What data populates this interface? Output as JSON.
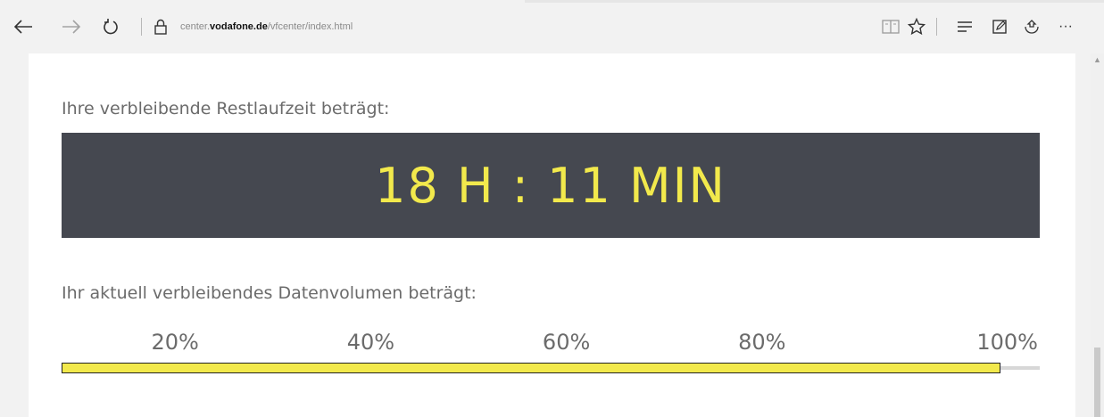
{
  "browser": {
    "url_prefix": "center.",
    "url_domain": "vodafone.de",
    "url_path": "/vfcenter/index.html",
    "icons": {
      "back": "back-arrow-icon",
      "forward": "forward-arrow-icon",
      "refresh": "refresh-icon",
      "lock": "lock-icon",
      "reading_view": "reading-view-icon",
      "favorite": "star-icon",
      "hub": "hub-icon",
      "note": "web-note-icon",
      "share": "share-icon",
      "more": "more-icon"
    },
    "more_glyph": "···"
  },
  "runtime": {
    "label": "Ihre verbleibende Restlaufzeit beträgt:",
    "value": "18 H : 11 MIN"
  },
  "volume": {
    "label": "Ihr aktuell verbleibendes Datenvolumen beträgt:",
    "ticks": [
      "20%",
      "40%",
      "60%",
      "80%",
      "100%"
    ],
    "percent_remaining": 96
  },
  "colors": {
    "accent": "#f2e94c",
    "timer_background": "#454850",
    "text": "#6b6b6b"
  }
}
